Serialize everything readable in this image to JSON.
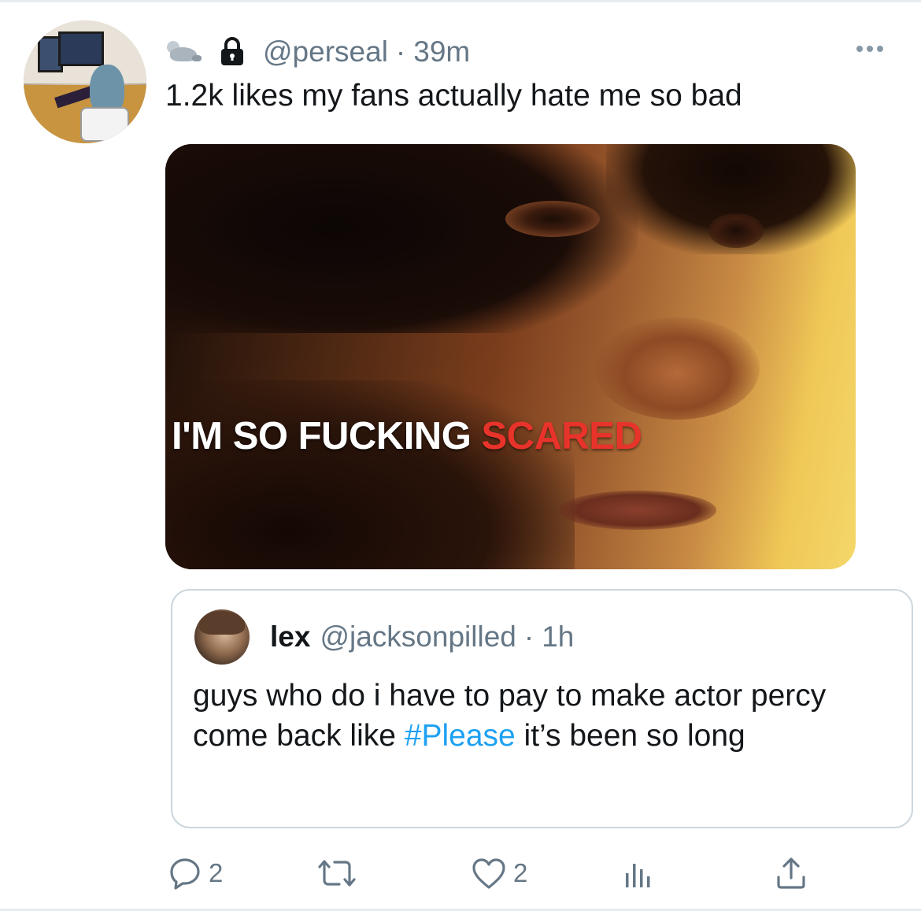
{
  "tweet": {
    "handle": "@perseal",
    "separator": "·",
    "time": "39m",
    "text": "1.2k likes my fans actually hate me so bad",
    "emoji_icon": "seal-emoji",
    "lock_icon": "lock-icon"
  },
  "media": {
    "caption_white": "I'M SO FUCKING",
    "caption_red": "SCARED",
    "caption_red_color": "#e8332b"
  },
  "quoted_tweet": {
    "name": "lex",
    "handle": "@jacksonpilled",
    "separator": "·",
    "time": "1h",
    "text_before": "guys who do i have to pay to make actor percy come back like ",
    "hashtag": "#Please",
    "text_after": " it’s been so long",
    "hashtag_color": "#1da1f2"
  },
  "actions": {
    "reply_count": "2",
    "like_count": "2"
  },
  "colors": {
    "secondary_text": "#657786",
    "icon": "#657786",
    "border": "#ccd6dd"
  }
}
